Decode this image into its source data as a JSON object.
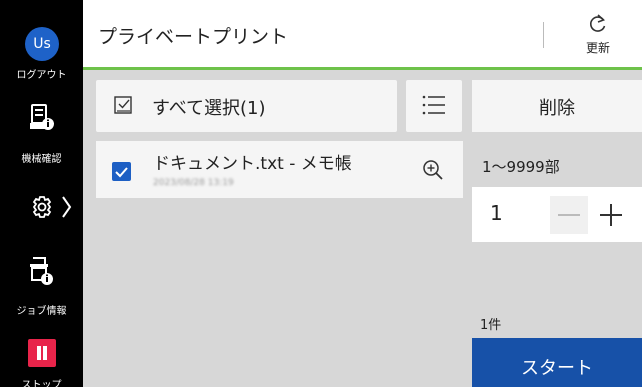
{
  "sidebar": {
    "avatar_text": "Us",
    "logout_label": "ログアウト",
    "machine_label": "機械確認",
    "job_label": "ジョブ情報",
    "stop_label": "ストップ"
  },
  "header": {
    "title": "プライベートプリント",
    "refresh_label": "更新"
  },
  "toolbar": {
    "select_all_label": "すべて選択(1)",
    "delete_label": "削除"
  },
  "documents": [
    {
      "name": "ドキュメント.txt - メモ帳",
      "date": "2023/08/28 13:19",
      "checked": true
    }
  ],
  "copies": {
    "range_label": "1～9999部",
    "value": "1"
  },
  "count_label": "1件",
  "start_label": "スタート",
  "colors": {
    "accent_green": "#6ec24a",
    "brand_blue": "#1751a8",
    "stop_red": "#e8244a"
  }
}
